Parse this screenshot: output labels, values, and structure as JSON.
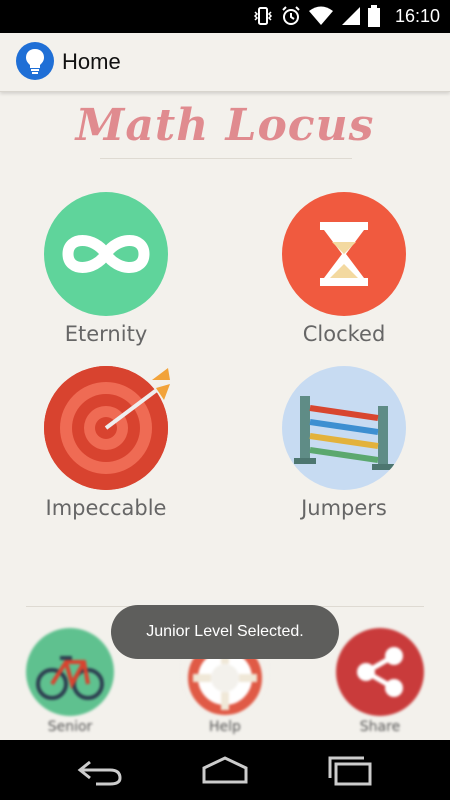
{
  "status_bar": {
    "time": "16:10",
    "icons": [
      "vibrate-icon",
      "alarm-icon",
      "wifi-icon",
      "signal-icon",
      "battery-icon"
    ]
  },
  "action_bar": {
    "icon": "lightbulb-icon",
    "title": "Home"
  },
  "logo": {
    "text": "Math Locus",
    "color": "#e08b8f"
  },
  "modes": [
    {
      "label": "Eternity",
      "icon": "infinity-icon",
      "color": "#5fd49b"
    },
    {
      "label": "Clocked",
      "icon": "hourglass-icon",
      "color": "#f05a3f"
    },
    {
      "label": "Impeccable",
      "icon": "target-icon",
      "color": "#d8432f"
    },
    {
      "label": "Jumpers",
      "icon": "hurdle-icon",
      "color": "#c7dbf2"
    }
  ],
  "bottom_bar": [
    {
      "label": "Senior",
      "icon": "bicycle-icon",
      "color": "#5fc18f"
    },
    {
      "label": "Help",
      "icon": "lifebuoy-icon",
      "color": "#f3f1ec"
    },
    {
      "label": "Share",
      "icon": "share-icon",
      "color": "#c93b3b"
    }
  ],
  "toast": {
    "text": "Junior Level Selected."
  },
  "nav_bar": [
    "back-icon",
    "home-icon",
    "recents-icon"
  ]
}
